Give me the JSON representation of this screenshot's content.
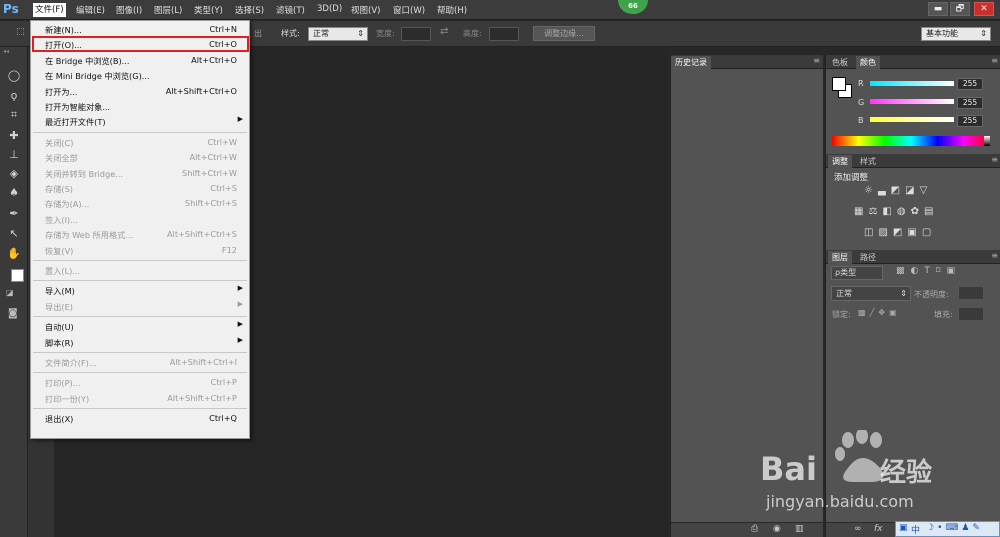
{
  "menubar": {
    "logo": "Ps",
    "items": [
      "文件(F)",
      "编辑(E)",
      "图像(I)",
      "图层(L)",
      "类型(Y)",
      "选择(S)",
      "滤镜(T)",
      "3D(D)",
      "视图(V)",
      "窗口(W)",
      "帮助(H)"
    ],
    "badge": "66",
    "win": {
      "min": "▬",
      "max": "🗗",
      "close": "✕"
    }
  },
  "options": {
    "edge_text": "出",
    "style_label": "样式:",
    "style_value": "正常",
    "width_label": "宽度:",
    "height_label": "高度:",
    "refine_button": "调整边缘...",
    "workspace": "基本功能"
  },
  "history": {
    "tab": "历史记录"
  },
  "color_panel": {
    "tabs": [
      "色板",
      "颜色"
    ],
    "channels": [
      {
        "label": "R",
        "value": "255",
        "color": "#00e5ff"
      },
      {
        "label": "G",
        "value": "255",
        "color": "#ff4dff"
      },
      {
        "label": "B",
        "value": "255",
        "color": "#ffff33"
      }
    ]
  },
  "adjust_panel": {
    "tabs": [
      "调整",
      "样式"
    ],
    "title": "添加调整"
  },
  "layers_panel": {
    "tabs": [
      "图层",
      "路径"
    ],
    "kind": "ρ类型",
    "blend": "正常",
    "opacity_label": "不透明度:",
    "lock_label": "锁定:",
    "fill_label": "填充:"
  },
  "file_menu": [
    {
      "label": "新建(N)...",
      "shortcut": "Ctrl+N",
      "disabled": false
    },
    {
      "label": "打开(O)...",
      "shortcut": "Ctrl+O",
      "disabled": false
    },
    {
      "label": "在 Bridge 中浏览(B)...",
      "shortcut": "Alt+Ctrl+O",
      "disabled": false
    },
    {
      "label": "在 Mini Bridge 中浏览(G)...",
      "shortcut": "",
      "disabled": false
    },
    {
      "label": "打开为...",
      "shortcut": "Alt+Shift+Ctrl+O",
      "disabled": false
    },
    {
      "label": "打开为智能对象...",
      "shortcut": "",
      "disabled": false
    },
    {
      "label": "最近打开文件(T)",
      "shortcut": "",
      "disabled": false,
      "submenu": true
    },
    {
      "sep": true
    },
    {
      "label": "关闭(C)",
      "shortcut": "Ctrl+W",
      "disabled": true
    },
    {
      "label": "关闭全部",
      "shortcut": "Alt+Ctrl+W",
      "disabled": true
    },
    {
      "label": "关闭并转到 Bridge...",
      "shortcut": "Shift+Ctrl+W",
      "disabled": true
    },
    {
      "label": "存储(S)",
      "shortcut": "Ctrl+S",
      "disabled": true
    },
    {
      "label": "存储为(A)...",
      "shortcut": "Shift+Ctrl+S",
      "disabled": true
    },
    {
      "label": "签入(I)...",
      "shortcut": "",
      "disabled": true
    },
    {
      "label": "存储为 Web 所用格式...",
      "shortcut": "Alt+Shift+Ctrl+S",
      "disabled": true
    },
    {
      "label": "恢复(V)",
      "shortcut": "F12",
      "disabled": true
    },
    {
      "sep": true
    },
    {
      "label": "置入(L)...",
      "shortcut": "",
      "disabled": true
    },
    {
      "sep": true
    },
    {
      "label": "导入(M)",
      "shortcut": "",
      "disabled": false,
      "submenu": true
    },
    {
      "label": "导出(E)",
      "shortcut": "",
      "disabled": true,
      "submenu": true
    },
    {
      "sep": true
    },
    {
      "label": "自动(U)",
      "shortcut": "",
      "disabled": false,
      "submenu": true
    },
    {
      "label": "脚本(R)",
      "shortcut": "",
      "disabled": false,
      "submenu": true
    },
    {
      "sep": true
    },
    {
      "label": "文件简介(F)...",
      "shortcut": "Alt+Shift+Ctrl+I",
      "disabled": true
    },
    {
      "sep": true
    },
    {
      "label": "打印(P)...",
      "shortcut": "Ctrl+P",
      "disabled": true
    },
    {
      "label": "打印一份(Y)",
      "shortcut": "Alt+Shift+Ctrl+P",
      "disabled": true
    },
    {
      "sep": true
    },
    {
      "label": "退出(X)",
      "shortcut": "Ctrl+Q",
      "disabled": false
    }
  ],
  "watermark": {
    "brand": "Bai",
    "brand2": "经验",
    "url": "jingyan.baidu.com"
  },
  "ime": {
    "label": "中"
  }
}
